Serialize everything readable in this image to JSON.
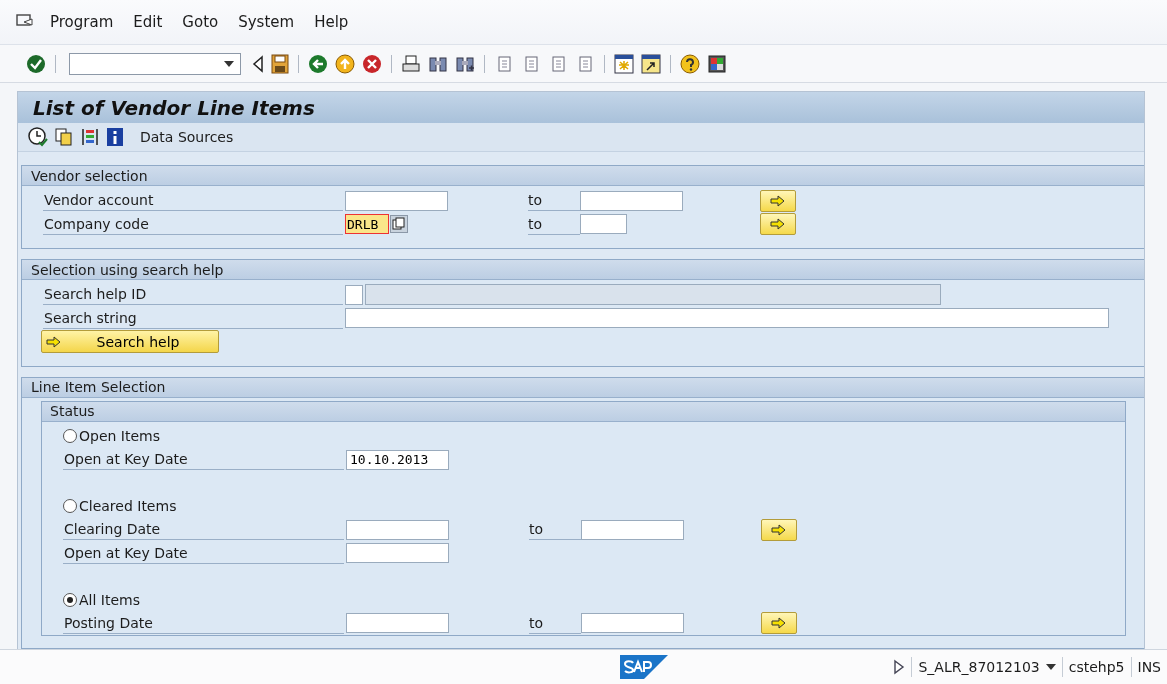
{
  "menu": [
    "Program",
    "Edit",
    "Goto",
    "System",
    "Help"
  ],
  "title": "List of Vendor Line Items",
  "app_toolbar": {
    "button": "Data Sources"
  },
  "sections": [
    {
      "title": "Vendor selection",
      "rows": [
        {
          "kind": "range",
          "label": "Vendor account",
          "low": "",
          "to": "to",
          "high": "",
          "highlighted": false
        },
        {
          "kind": "short_range",
          "label": "Company code",
          "low": "DRLB",
          "to": "to",
          "high": "",
          "highlighted": true
        }
      ]
    },
    {
      "title": "Selection using search help",
      "rows": [
        {
          "kind": "search_id",
          "label": "Search help ID"
        },
        {
          "kind": "wide",
          "label": "Search string"
        },
        {
          "kind": "button",
          "label": "Search help"
        }
      ]
    },
    {
      "title": "Line Item Selection",
      "group": {
        "title": "Status",
        "rows": [
          {
            "kind": "radio",
            "label": "Open Items",
            "selected": false
          },
          {
            "kind": "single",
            "label": "Open at Key Date",
            "value": "10.10.2013"
          },
          {
            "kind": "radio",
            "label": "Cleared Items",
            "selected": false
          },
          {
            "kind": "range",
            "label": "Clearing Date",
            "low": "",
            "to": "to",
            "high": "",
            "highlighted": false
          },
          {
            "kind": "single",
            "label": "Open at Key Date",
            "value": ""
          },
          {
            "kind": "radio",
            "label": "All Items",
            "selected": true
          },
          {
            "kind": "range",
            "label": "Posting Date",
            "low": "",
            "to": "to",
            "high": "",
            "highlighted": false
          }
        ]
      }
    }
  ],
  "status_bar": {
    "transaction": "S_ALR_87012103",
    "server": "cstehp5",
    "mode": "INS"
  }
}
